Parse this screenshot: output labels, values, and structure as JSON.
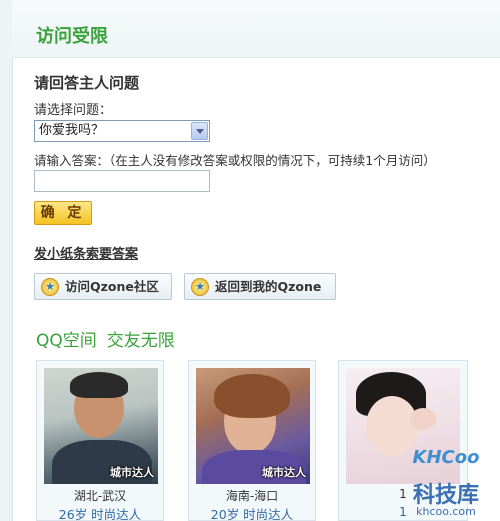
{
  "header": {
    "title": "访问受限"
  },
  "question_section": {
    "title": "请回答主人问题",
    "select_label": "请选择问题：",
    "selected_question": "你爱我吗？",
    "answer_label": "请输入答案：（在主人没有修改答案或权限的情况下，可持续1个月访问）",
    "answer_value": "",
    "confirm_label": "确 定"
  },
  "note_link": "发小纸条索要答案",
  "buttons": {
    "community": "访问Qzone社区",
    "my_qzone": "返回到我的Qzone"
  },
  "promo": {
    "title1": "QQ空间",
    "title2": "交友无限"
  },
  "cards": [
    {
      "badge": "城市达人",
      "location": "湖北-武汉",
      "info": "26岁  时尚达人"
    },
    {
      "badge": "城市达人",
      "location": "海南-海口",
      "info": "20岁  时尚达人"
    },
    {
      "badge": "",
      "location": "1",
      "info": "1"
    }
  ],
  "watermark": {
    "brand": "KHCoo",
    "cn": "科技库",
    "url": "khcoo.com"
  },
  "colors": {
    "accent_green": "#3aa23a",
    "link_blue": "#2f6aa8",
    "button_gold": "#f4c221"
  }
}
